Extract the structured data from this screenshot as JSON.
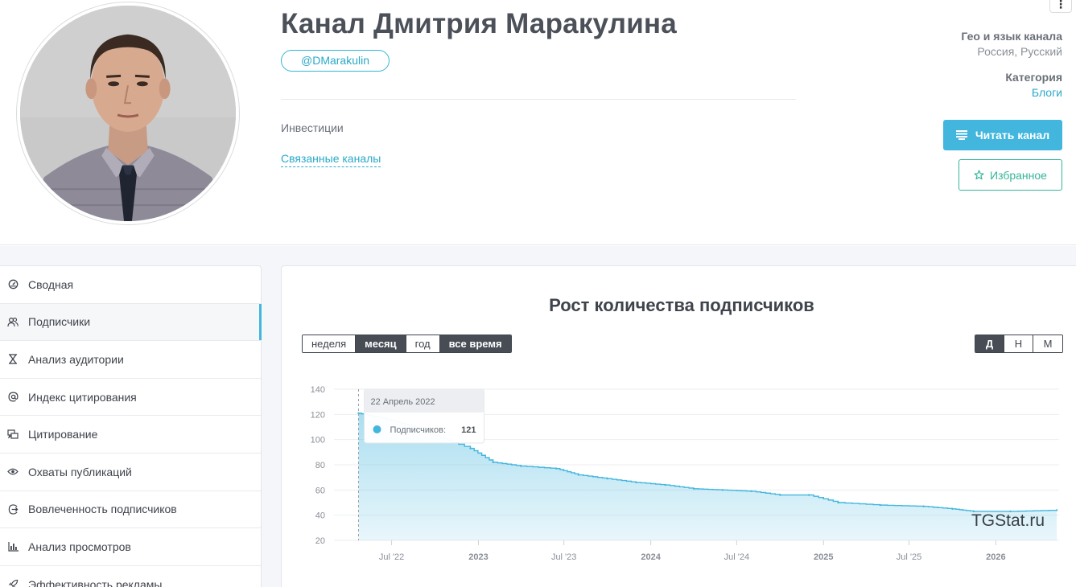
{
  "channel": {
    "title": "Канал Дмитрия Маракулина",
    "handle": "@DMarakulin",
    "description": "Инвестиции",
    "related_link": "Связанные каналы",
    "geo_label": "Гео и язык канала",
    "geo_value": "Россия, Русский",
    "category_label": "Категория",
    "category_value": "Блоги",
    "read_button": "Читать канал",
    "favorite_button": "Избранное",
    "more_menu": "⋮"
  },
  "sidebar": {
    "items": [
      {
        "label": "Сводная",
        "icon": "gauge-icon"
      },
      {
        "label": "Подписчики",
        "icon": "users-icon",
        "active": true
      },
      {
        "label": "Анализ аудитории",
        "icon": "hourglass-icon"
      },
      {
        "label": "Индекс цитирования",
        "icon": "at-icon"
      },
      {
        "label": "Цитирование",
        "icon": "quote-icon"
      },
      {
        "label": "Охваты публикаций",
        "icon": "eye-icon"
      },
      {
        "label": "Вовлеченность подписчиков",
        "icon": "engagement-icon"
      },
      {
        "label": "Анализ просмотров",
        "icon": "bar-chart-icon"
      },
      {
        "label": "Эффективность рекламы",
        "icon": "rocket-icon"
      }
    ]
  },
  "chart_controls": {
    "periods": [
      {
        "label": "неделя",
        "active": false
      },
      {
        "label": "месяц",
        "active": true
      },
      {
        "label": "год",
        "active": false
      },
      {
        "label": "все время",
        "active": true
      }
    ],
    "granularity": [
      {
        "label": "Д",
        "active": true
      },
      {
        "label": "Н",
        "active": false
      },
      {
        "label": "М",
        "active": false
      }
    ]
  },
  "chart_data": {
    "type": "area",
    "title": "Рост количества подписчиков",
    "ylim": [
      20,
      140
    ],
    "yticks": [
      20,
      40,
      60,
      80,
      100,
      120,
      140
    ],
    "xlim": [
      "2022-03-01",
      "2026-05-15"
    ],
    "xticks": [
      {
        "label": "Jul '22",
        "date": "2022-07-01"
      },
      {
        "label": "2023",
        "date": "2023-01-01"
      },
      {
        "label": "Jul '23",
        "date": "2023-07-01"
      },
      {
        "label": "2024",
        "date": "2024-01-01"
      },
      {
        "label": "Jul '24",
        "date": "2024-07-01"
      },
      {
        "label": "2025",
        "date": "2025-01-01"
      },
      {
        "label": "Jul '25",
        "date": "2025-07-01"
      },
      {
        "label": "2026",
        "date": "2026-01-01"
      }
    ],
    "grid": true,
    "series": [
      {
        "name": "Подписчиков",
        "color": "#43b6de",
        "points": [
          [
            "2022-04-22",
            121
          ],
          [
            "2022-06-01",
            118
          ],
          [
            "2022-08-01",
            112
          ],
          [
            "2022-10-01",
            103
          ],
          [
            "2022-12-15",
            93
          ],
          [
            "2023-02-01",
            82
          ],
          [
            "2023-04-01",
            79
          ],
          [
            "2023-06-15",
            77
          ],
          [
            "2023-08-01",
            72
          ],
          [
            "2023-10-01",
            69
          ],
          [
            "2023-12-01",
            66
          ],
          [
            "2024-02-01",
            64
          ],
          [
            "2024-04-01",
            61
          ],
          [
            "2024-06-01",
            60
          ],
          [
            "2024-08-01",
            59
          ],
          [
            "2024-10-01",
            56
          ],
          [
            "2024-12-01",
            56
          ],
          [
            "2025-02-01",
            50
          ],
          [
            "2025-05-01",
            48
          ],
          [
            "2025-08-01",
            47
          ],
          [
            "2025-10-01",
            45
          ],
          [
            "2025-11-15",
            43
          ],
          [
            "2026-02-01",
            43
          ],
          [
            "2026-05-10",
            44
          ]
        ]
      }
    ],
    "tooltip": {
      "date": "22 Апрель 2022",
      "label": "Подписчиков:",
      "value": "121"
    },
    "watermark": "TGStat.ru"
  }
}
